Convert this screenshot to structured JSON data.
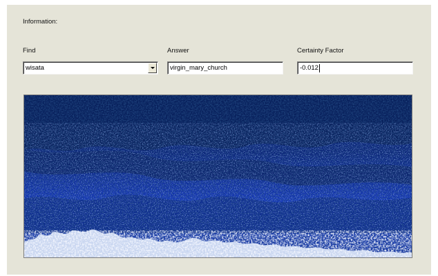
{
  "section": {
    "title": "Information:"
  },
  "find": {
    "label": "Find",
    "value": "wisata"
  },
  "answer": {
    "label": "Answer",
    "value": "virgin_mary_church"
  },
  "certainty": {
    "label": "Certainty Factor",
    "value": "-0.012"
  },
  "image": {
    "subject": "snowy-blue-forest-photo",
    "colors": {
      "sky_band": "#0b2386",
      "dark_canopy": "#071a5a",
      "mid_trees": "#1238c4",
      "snow": "#e8eef8"
    }
  }
}
